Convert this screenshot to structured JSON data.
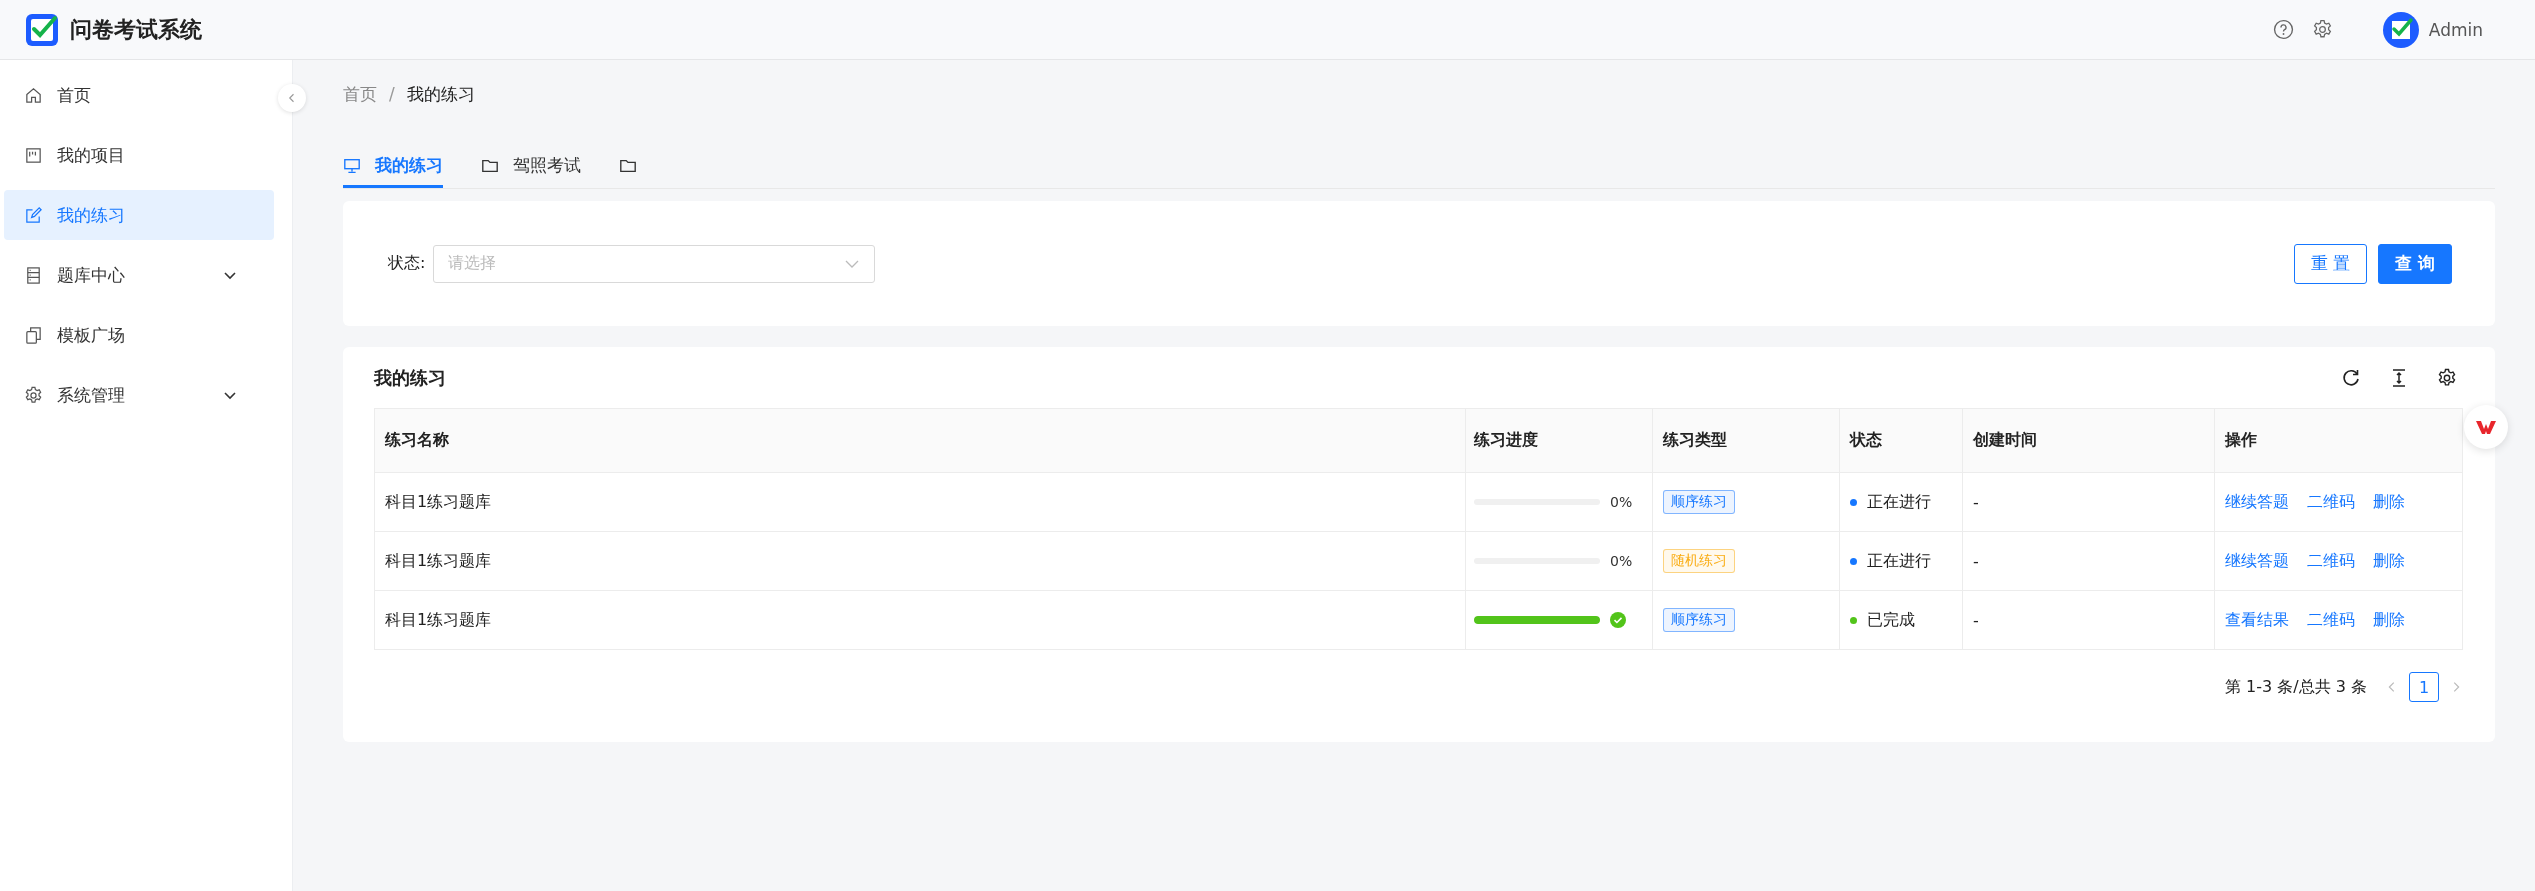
{
  "header": {
    "title": "问卷考试系统",
    "user": "Admin"
  },
  "sidebar": {
    "items": [
      {
        "label": "首页",
        "selected": false,
        "kind": "link"
      },
      {
        "label": "我的项目",
        "selected": false,
        "kind": "link"
      },
      {
        "label": "我的练习",
        "selected": true,
        "kind": "link"
      },
      {
        "label": "题库中心",
        "selected": false,
        "kind": "submenu",
        "expanded": false
      },
      {
        "label": "模板广场",
        "selected": false,
        "kind": "link"
      },
      {
        "label": "系统管理",
        "selected": false,
        "kind": "submenu",
        "expanded": false
      }
    ]
  },
  "breadcrumb": {
    "items": [
      "首页",
      "我的练习"
    ],
    "separator": "/"
  },
  "tabs": [
    {
      "label": "我的练习",
      "selected": true
    },
    {
      "label": "驾照考试",
      "selected": false
    },
    {
      "selected": false
    }
  ],
  "filter": {
    "label": "状态:",
    "placeholder": "请选择",
    "buttons": [
      {
        "label": "重 置",
        "kind": "secondary"
      },
      {
        "label": "查 询",
        "kind": "primary"
      }
    ]
  },
  "table": {
    "title": "我的练习",
    "columns": [
      "练习名称",
      "练习进度",
      "练习类型",
      "状态",
      "创建时间",
      "操作"
    ],
    "rows": [
      {
        "name": "科目1练习题库",
        "progress": {
          "level": 0,
          "done": false,
          "reading": "0%"
        },
        "type": {
          "label": "顺序练习",
          "color": "#1677ff"
        },
        "status": {
          "label": "正在进行",
          "color": "#1677ff"
        },
        "created": "-",
        "actions": [
          "继续答题",
          "二维码",
          "删除"
        ]
      },
      {
        "name": "科目1练习题库",
        "progress": {
          "level": 0,
          "done": false,
          "reading": "0%"
        },
        "type": {
          "label": "随机练习",
          "color": "#faad14"
        },
        "status": {
          "label": "正在进行",
          "color": "#1677ff"
        },
        "created": "-",
        "actions": [
          "继续答题",
          "二维码",
          "删除"
        ]
      },
      {
        "name": "科目1练习题库",
        "progress": {
          "level": 1,
          "done": true
        },
        "type": {
          "label": "顺序练习",
          "color": "#1677ff"
        },
        "status": {
          "label": "已完成",
          "color": "#52c41a"
        },
        "created": "-",
        "actions": [
          "查看结果",
          "二维码",
          "删除"
        ]
      }
    ]
  },
  "pagination": {
    "summary": "第 1-3 条/总共 3 条",
    "pages": [
      {
        "label": "1",
        "selected": true
      }
    ]
  }
}
